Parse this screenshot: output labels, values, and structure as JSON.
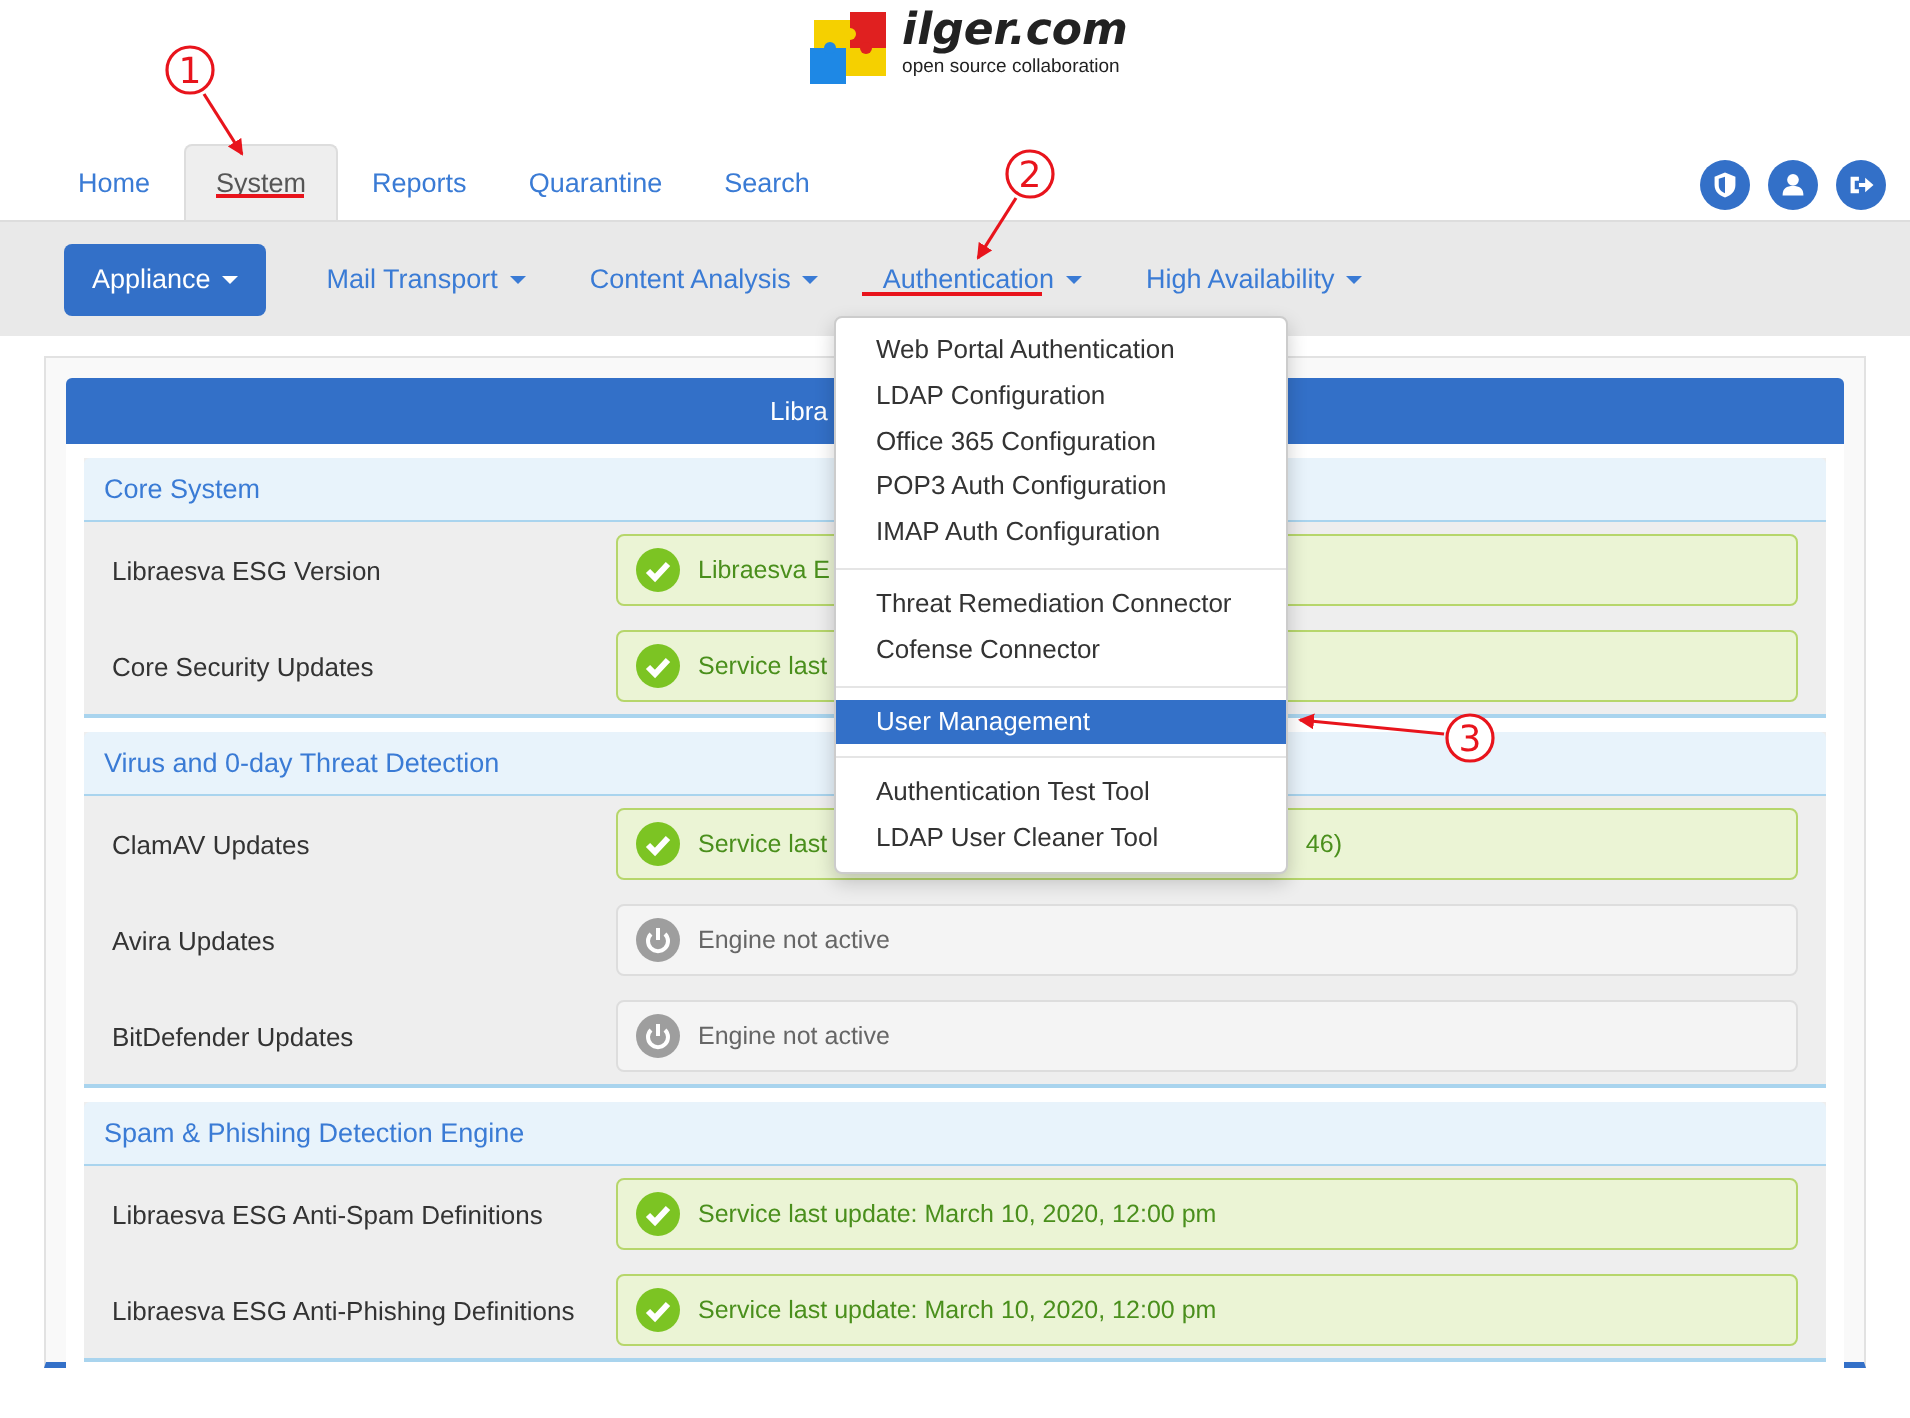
{
  "logo": {
    "name": "ilger.com",
    "tagline": "open source collaboration"
  },
  "tabs": [
    {
      "label": "Home",
      "selected": false
    },
    {
      "label": "System",
      "selected": true
    },
    {
      "label": "Reports",
      "selected": false
    },
    {
      "label": "Quarantine",
      "selected": false
    },
    {
      "label": "Search",
      "selected": false
    }
  ],
  "subnav": [
    {
      "label": "Appliance",
      "selected": true
    },
    {
      "label": "Mail Transport",
      "selected": false
    },
    {
      "label": "Content Analysis",
      "selected": false
    },
    {
      "label": "Authentication",
      "selected": false
    },
    {
      "label": "High Availability",
      "selected": false
    }
  ],
  "dropdown": {
    "groups": [
      [
        {
          "label": "Web Portal Authentication",
          "selected": false
        },
        {
          "label": "LDAP Configuration",
          "selected": false
        },
        {
          "label": "Office 365 Configuration",
          "selected": false
        },
        {
          "label": "POP3 Auth Configuration",
          "selected": false
        },
        {
          "label": "IMAP Auth Configuration",
          "selected": false
        }
      ],
      [
        {
          "label": "Threat Remediation Connector",
          "selected": false
        },
        {
          "label": "Cofense Connector",
          "selected": false
        }
      ],
      [
        {
          "label": "User Management",
          "selected": true
        }
      ],
      [
        {
          "label": "Authentication Test Tool",
          "selected": false
        },
        {
          "label": "LDAP User Cleaner Tool",
          "selected": false
        }
      ]
    ]
  },
  "panel": {
    "title": "Libra",
    "sections": [
      {
        "title": "Core System",
        "rows": [
          {
            "label": "Libraesva ESG Version",
            "status": {
              "kind": "ok",
              "text": "Libraesva E"
            }
          },
          {
            "label": "Core Security Updates",
            "status": {
              "kind": "ok",
              "text": "Service last"
            }
          }
        ]
      },
      {
        "title": "Virus and 0-day Threat Detection",
        "rows": [
          {
            "label": "ClamAV Updates",
            "status": {
              "kind": "ok",
              "text": "Service last",
              "tail": "46)"
            }
          },
          {
            "label": "Avira Updates",
            "status": {
              "kind": "inactive",
              "text": "Engine not active"
            }
          },
          {
            "label": "BitDefender Updates",
            "status": {
              "kind": "inactive",
              "text": "Engine not active"
            }
          }
        ]
      },
      {
        "title": "Spam & Phishing Detection Engine",
        "rows": [
          {
            "label": "Libraesva ESG Anti-Spam Definitions",
            "status": {
              "kind": "ok",
              "text": "Service last update: March 10, 2020, 12:00 pm"
            }
          },
          {
            "label": "Libraesva ESG Anti-Phishing Definitions",
            "status": {
              "kind": "ok",
              "text": "Service last update: March 10, 2020, 12:00 pm"
            }
          }
        ]
      }
    ]
  },
  "annotations": [
    {
      "number": "1"
    },
    {
      "number": "2"
    },
    {
      "number": "3"
    }
  ]
}
